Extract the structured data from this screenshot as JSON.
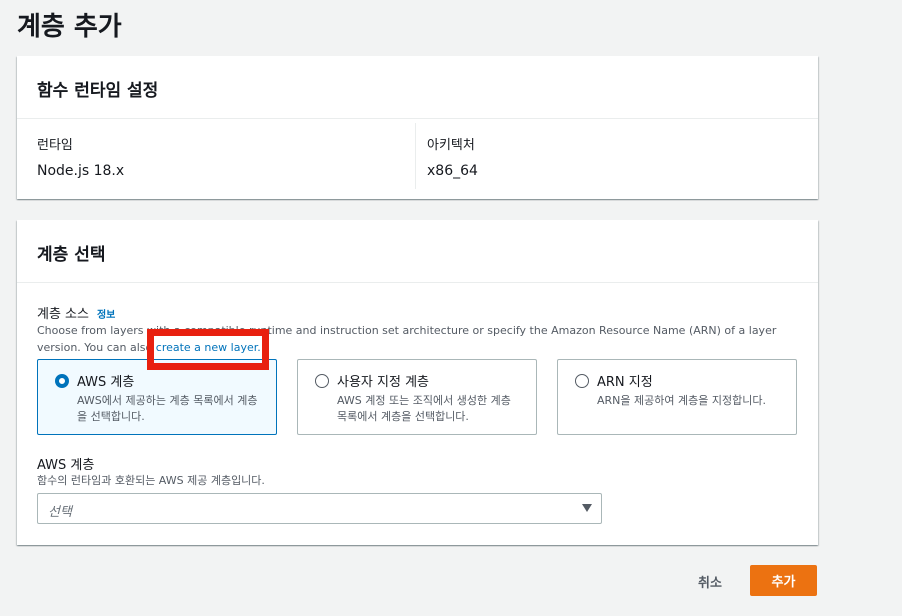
{
  "page": {
    "title": "계층 추가"
  },
  "runtime_panel": {
    "heading": "함수 런타임 설정",
    "runtime": {
      "label": "런타임",
      "value": "Node.js 18.x"
    },
    "architecture": {
      "label": "아키텍처",
      "value": "x86_64"
    }
  },
  "layer_panel": {
    "heading": "계층 선택",
    "source": {
      "label": "계층 소스",
      "info": "정보",
      "description_line1": "Choose from layers with a compatible runtime and instruction set architecture or specify the Amazon Resource Name (ARN) of a layer",
      "description_line2": "version. You can also",
      "create_link": "create a new layer."
    },
    "options": [
      {
        "title": "AWS 계층",
        "description": "AWS에서 제공하는 계층 목록에서 계층을 선택합니다.",
        "selected": true
      },
      {
        "title": "사용자 지정 계층",
        "description": "AWS 계정 또는 조직에서 생성한 계층 목록에서 계층을 선택합니다.",
        "selected": false
      },
      {
        "title": "ARN 지정",
        "description": "ARN을 제공하여 계층을 지정합니다.",
        "selected": false
      }
    ],
    "aws_layer": {
      "label": "AWS 계층",
      "description": "함수의 런타임과 호환되는 AWS 제공 계층입니다.",
      "placeholder": "선택"
    }
  },
  "actions": {
    "cancel": "취소",
    "add": "추가"
  },
  "colors": {
    "accent": "#0073bb",
    "primary_button": "#ec7211",
    "annotation": "#e8200f"
  },
  "icons": {
    "dropdown": "caret-down-icon"
  }
}
